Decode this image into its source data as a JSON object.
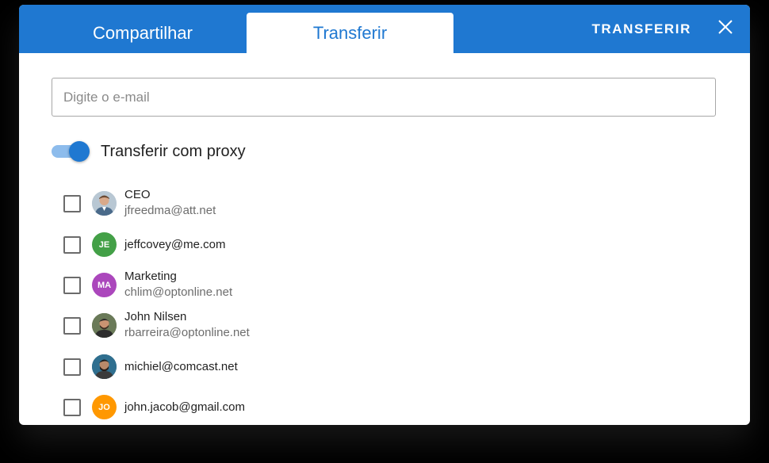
{
  "tabs": {
    "share_label": "Compartilhar",
    "transfer_label": "Transferir"
  },
  "header": {
    "action_label": "TRANSFERIR",
    "close_icon": "close-icon"
  },
  "email_input": {
    "placeholder": "Digite o e-mail",
    "value": ""
  },
  "proxy_toggle": {
    "label": "Transferir com proxy",
    "checked": true
  },
  "colors": {
    "accent": "#1f78d1",
    "toggle_track": "#8dbcec",
    "avatar_green": "#43a047",
    "avatar_purple": "#ab47bc",
    "avatar_orange": "#ff9800"
  },
  "contacts": [
    {
      "name": "CEO",
      "email": "jfreedma@att.net",
      "avatar": "photo",
      "initials": ""
    },
    {
      "name": "",
      "email": "jeffcovey@me.com",
      "avatar": "initials",
      "initials": "JE"
    },
    {
      "name": "Marketing",
      "email": "chlim@optonline.net",
      "avatar": "initials",
      "initials": "MA"
    },
    {
      "name": "John Nilsen",
      "email": "rbarreira@optonline.net",
      "avatar": "photo",
      "initials": ""
    },
    {
      "name": "",
      "email": "michiel@comcast.net",
      "avatar": "photo",
      "initials": ""
    },
    {
      "name": "",
      "email": "john.jacob@gmail.com",
      "avatar": "initials",
      "initials": "JO"
    }
  ]
}
